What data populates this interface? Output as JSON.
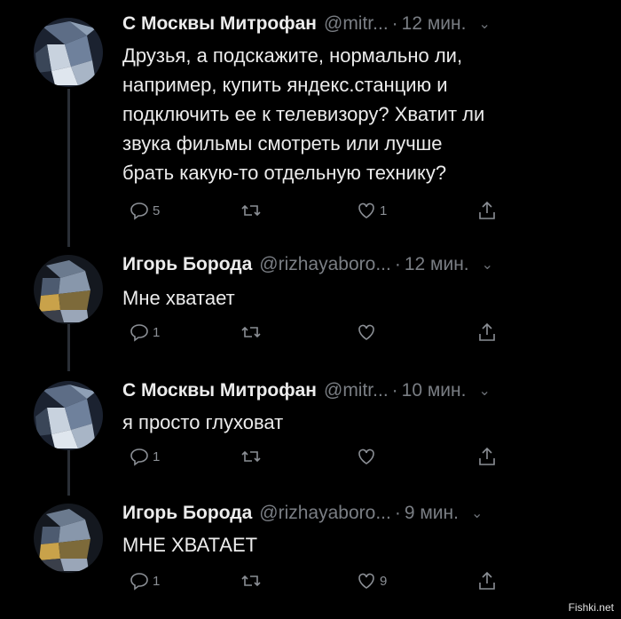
{
  "tweets": [
    {
      "name": "С Москвы Митрофан",
      "handle": "@mitr...",
      "time": "12 мин.",
      "text": "Друзья, а подскажите, нормально ли,\nнапример, купить яндекс.станцию и\nподключить ее к телевизору? Хватит ли\nзвука фильмы смотреть или лучше\nбрать какую-то отдельную технику?",
      "replies": "5",
      "retweets": "",
      "likes": "1"
    },
    {
      "name": "Игорь Борода",
      "handle": "@rizhayaboro...",
      "time": "12 мин.",
      "text": "Мне хватает",
      "replies": "1",
      "retweets": "",
      "likes": ""
    },
    {
      "name": "С Москвы Митрофан",
      "handle": "@mitr...",
      "time": "10 мин.",
      "text": "я просто глуховат",
      "replies": "1",
      "retweets": "",
      "likes": ""
    },
    {
      "name": "Игорь Борода",
      "handle": "@rizhayaboro...",
      "time": "9 мин.",
      "text": "МНЕ ХВАТАЕТ",
      "replies": "1",
      "retweets": "",
      "likes": "9"
    }
  ],
  "separator": "·",
  "caret": "⌄",
  "icons": {
    "reply": "reply-icon",
    "retweet": "retweet-icon",
    "like": "heart-icon",
    "share": "share-icon",
    "menu": "chevron-down-icon"
  },
  "colors": {
    "background": "#000000",
    "text": "#ececec",
    "secondary": "#7a7e84"
  },
  "watermark": "Fishki.net"
}
